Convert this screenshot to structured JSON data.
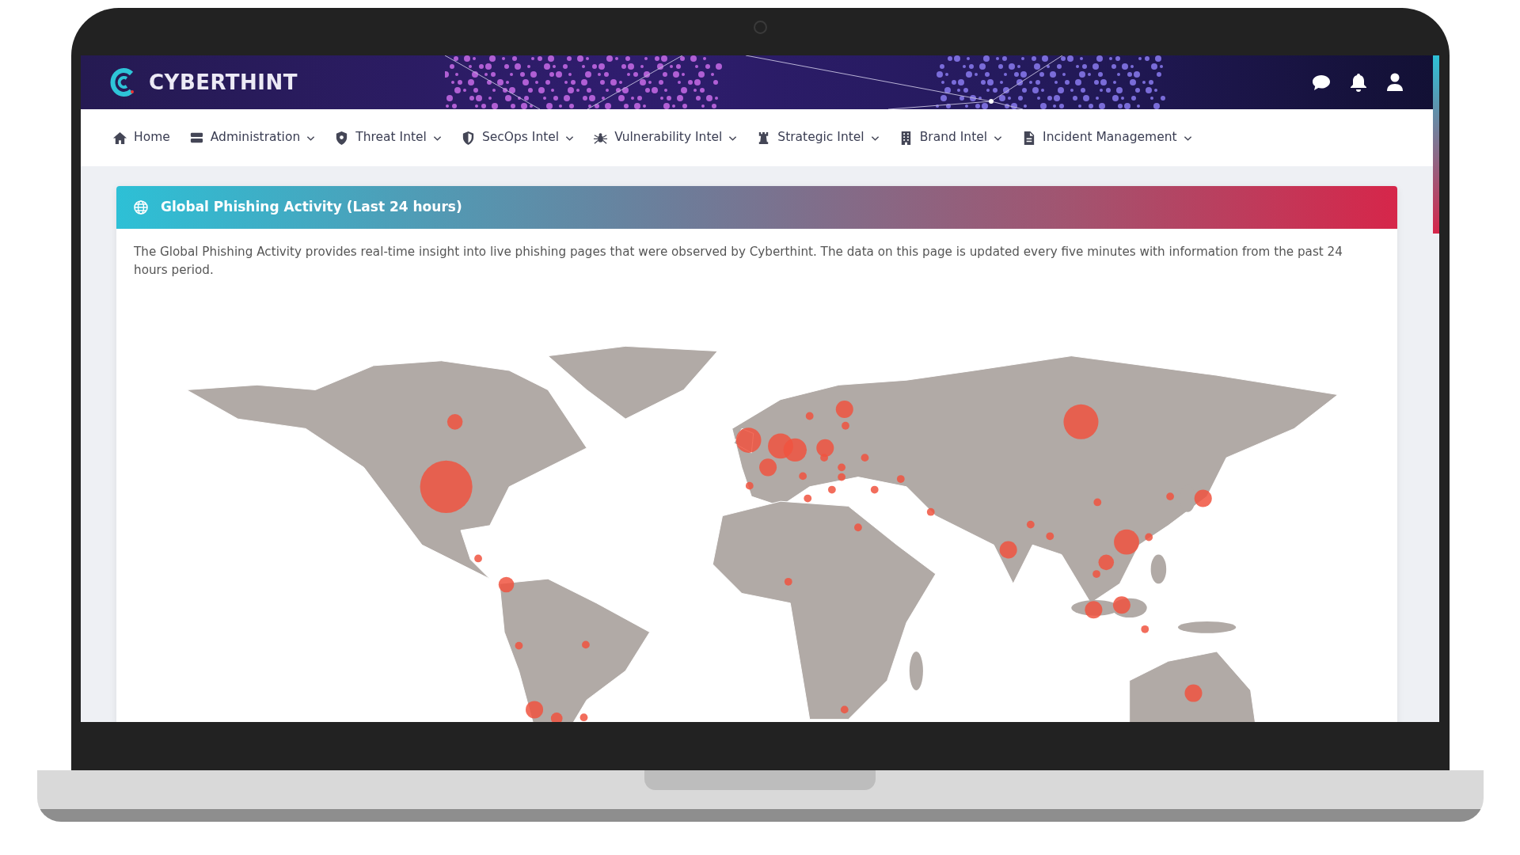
{
  "brand": {
    "name": "CYBERTHINT"
  },
  "nav": [
    {
      "label": "Home",
      "has_menu": false
    },
    {
      "label": "Administration",
      "has_menu": true
    },
    {
      "label": "Threat Intel",
      "has_menu": true
    },
    {
      "label": "SecOps Intel",
      "has_menu": true
    },
    {
      "label": "Vulnerability Intel",
      "has_menu": true
    },
    {
      "label": "Strategic Intel",
      "has_menu": true
    },
    {
      "label": "Brand Intel",
      "has_menu": true
    },
    {
      "label": "Incident Management",
      "has_menu": true
    }
  ],
  "card": {
    "title": "Global Phishing Activity (Last 24 hours)",
    "description": "The Global Phishing Activity provides real-time insight into live phishing pages that were observed by Cyberthint. The data on this page is updated every five minutes with information from the past 24 hours period."
  }
}
